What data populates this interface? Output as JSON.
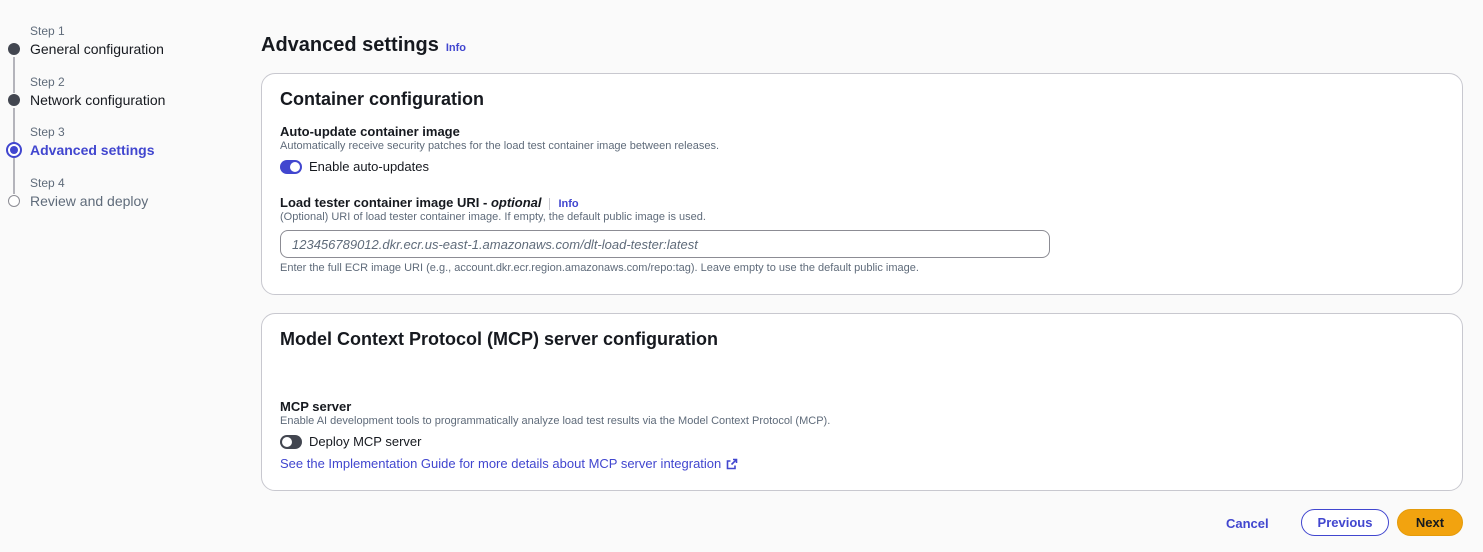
{
  "wizard": {
    "steps": [
      {
        "step": "Step 1",
        "label": "General configuration"
      },
      {
        "step": "Step 2",
        "label": "Network configuration"
      },
      {
        "step": "Step 3",
        "label": "Advanced settings"
      },
      {
        "step": "Step 4",
        "label": "Review and deploy"
      }
    ]
  },
  "header": {
    "title": "Advanced settings",
    "info": "Info"
  },
  "container_config": {
    "title": "Container configuration",
    "auto_update": {
      "label": "Auto-update container image",
      "description": "Automatically receive security patches for the load test container image between releases.",
      "toggle_label": "Enable auto-updates",
      "enabled": true
    },
    "image_uri": {
      "label": "Load tester container image URI - ",
      "optional": "optional",
      "info": "Info",
      "description": "(Optional) URI of load tester container image. If empty, the default public image is used.",
      "value": "",
      "placeholder": "123456789012.dkr.ecr.us-east-1.amazonaws.com/dlt-load-tester:latest",
      "hint": "Enter the full ECR image URI (e.g., account.dkr.ecr.region.amazonaws.com/repo:tag). Leave empty to use the default public image."
    }
  },
  "mcp_config": {
    "title": "Model Context Protocol (MCP) server configuration",
    "server": {
      "label": "MCP server",
      "description": "Enable AI development tools to programmatically analyze load test results via the Model Context Protocol (MCP).",
      "toggle_label": "Deploy MCP server",
      "enabled": false
    },
    "guide_link": "See the Implementation Guide for more details about MCP server integration"
  },
  "footer": {
    "cancel": "Cancel",
    "previous": "Previous",
    "next": "Next"
  },
  "colors": {
    "accent": "#4146cf",
    "primary_button": "#f2a30f"
  }
}
